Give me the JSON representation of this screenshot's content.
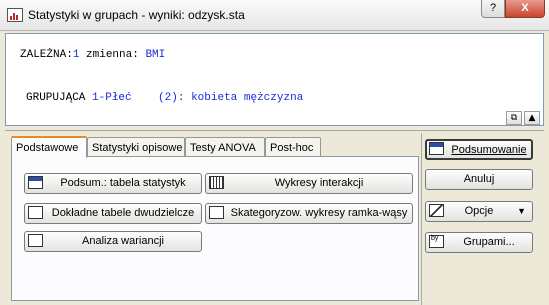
{
  "window": {
    "title": "Statystyki w grupach - wyniki: odzysk.sta",
    "help_label": "?",
    "close_label": "X"
  },
  "variables": {
    "dependent_label": "ZALEŻNA:",
    "dependent_count": "1",
    "dependent_text": " zmienna: ",
    "dependent_value": "BMI",
    "grouping_label": "GRUPUJĄCA",
    "grouping_index": "1-Płeć",
    "grouping_count": "(2):",
    "grouping_value": "kobieta mężczyzna"
  },
  "tabs": [
    {
      "label": "Podstawowe",
      "active": true
    },
    {
      "label": "Statystyki opisowe",
      "active": false
    },
    {
      "label": "Testy ANOVA",
      "active": false
    },
    {
      "label": "Post-hoc",
      "active": false
    }
  ],
  "buttons": {
    "summary_table": "Podsum.: tabela statystyk",
    "interaction_plots": "Wykresy interakcji",
    "detailed_tables": "Dokładne tabele dwudzielcze",
    "box_plots": "Skategoryzow. wykresy ramka-wąsy",
    "anova": "Analiza wariancji"
  },
  "sidebar": {
    "summary": "Podsumowanie",
    "cancel": "Anuluj",
    "options": "Opcje",
    "groups": "Grupami..."
  }
}
